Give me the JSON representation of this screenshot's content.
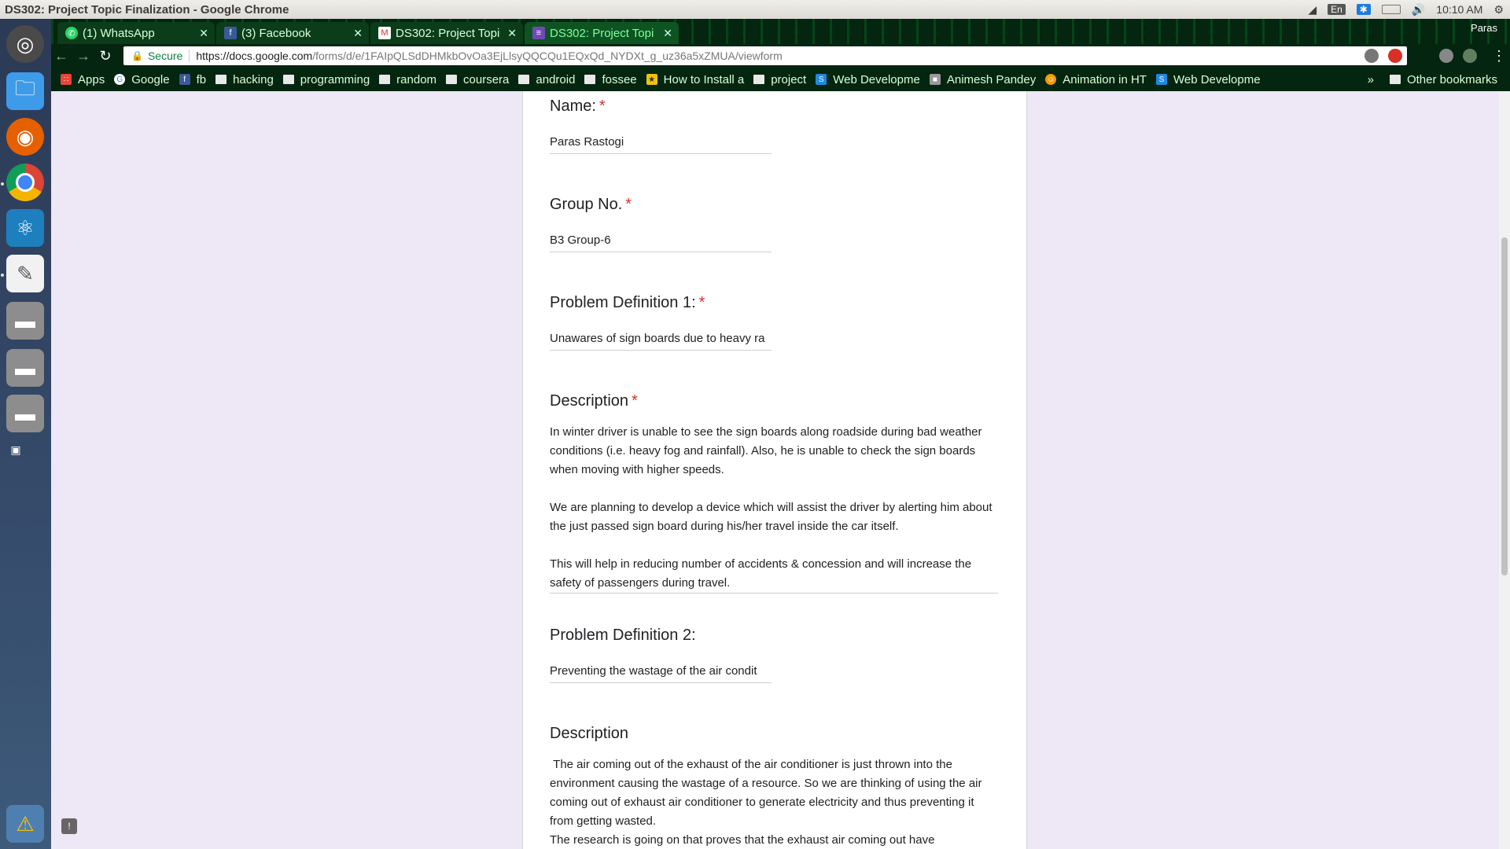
{
  "window": {
    "title": "DS302: Project Topic Finalization - Google Chrome"
  },
  "panel": {
    "lang": "En",
    "time": "10:10 AM"
  },
  "launcher": {
    "items": [
      "ubuntu-dash-icon",
      "files-icon",
      "firefox-icon",
      "chrome-icon",
      "atom-icon",
      "text-editor-icon",
      "disk-drive-icon",
      "disk-drive-icon",
      "disk-drive-icon",
      "workspace-switcher-icon",
      "updates-warning-icon"
    ]
  },
  "browser": {
    "profile": "Paras",
    "tabs": [
      {
        "label": "(1) WhatsApp",
        "icon": "whatsapp-icon"
      },
      {
        "label": "(3) Facebook",
        "icon": "facebook-icon"
      },
      {
        "label": "DS302: Project Topi",
        "icon": "gmail-icon"
      },
      {
        "label": "DS302: Project Topi",
        "icon": "google-forms-icon"
      }
    ],
    "address": {
      "secure": "Secure",
      "host": "https://docs.google.com",
      "path": "/forms/d/e/1FAIpQLSdDHMkbOvOa3EjLlsyQQCQu1EQxQd_NYDXt_g_uz36a5xZMUA/viewform"
    },
    "bookmarks": [
      {
        "label": "Apps",
        "icon": "apps-grid-icon"
      },
      {
        "label": "Google",
        "icon": "google-icon"
      },
      {
        "label": "fb",
        "icon": "facebook-icon"
      },
      {
        "label": "hacking",
        "icon": "folder-icon"
      },
      {
        "label": "programming",
        "icon": "folder-icon"
      },
      {
        "label": "random",
        "icon": "folder-icon"
      },
      {
        "label": "coursera",
        "icon": "folder-icon"
      },
      {
        "label": "android",
        "icon": "folder-icon"
      },
      {
        "label": "fossee",
        "icon": "folder-icon"
      },
      {
        "label": "How to Install a",
        "icon": "bulb-icon"
      },
      {
        "label": "project",
        "icon": "folder-icon"
      },
      {
        "label": "Web Developme",
        "icon": "site-icon"
      },
      {
        "label": "Animesh Pandey",
        "icon": "site-icon"
      },
      {
        "label": "Animation in HT",
        "icon": "site-icon"
      },
      {
        "label": "Web Developme",
        "icon": "site-icon"
      }
    ],
    "more": "»",
    "other_bookmarks": "Other bookmarks"
  },
  "form": {
    "q1": {
      "title": "Name:",
      "required": "*",
      "answer": "Paras Rastogi"
    },
    "q2": {
      "title": "Group No.",
      "required": "*",
      "answer": "B3 Group-6"
    },
    "q3": {
      "title": "Problem Definition 1:",
      "required": "*",
      "answer": "Unawares of sign boards due to heavy ra"
    },
    "q4": {
      "title": "Description",
      "required": "*",
      "p1": "In winter driver is unable to see the sign boards along roadside during bad weather conditions (i.e. heavy fog and rainfall). Also, he is unable to check the sign boards when moving with higher speeds.",
      "p2": "We are planning to develop a device which will assist the driver by alerting him about the just passed sign board during his/her travel inside the car itself.",
      "p3": "This will help in reducing number of accidents & concession and will increase the safety of passengers during travel."
    },
    "q5": {
      "title": "Problem Definition 2:",
      "answer": "Preventing the wastage of the air condit"
    },
    "q6": {
      "title": "Description",
      "p1": " The air coming out of the exhaust of the air conditioner is just thrown into the environment causing the wastage of a resource. So we are thinking of using the air coming out of exhaust air conditioner to generate electricity and thus preventing it from getting wasted.",
      "p2": "The research is going on that proves that the exhaust air coming out have"
    }
  }
}
